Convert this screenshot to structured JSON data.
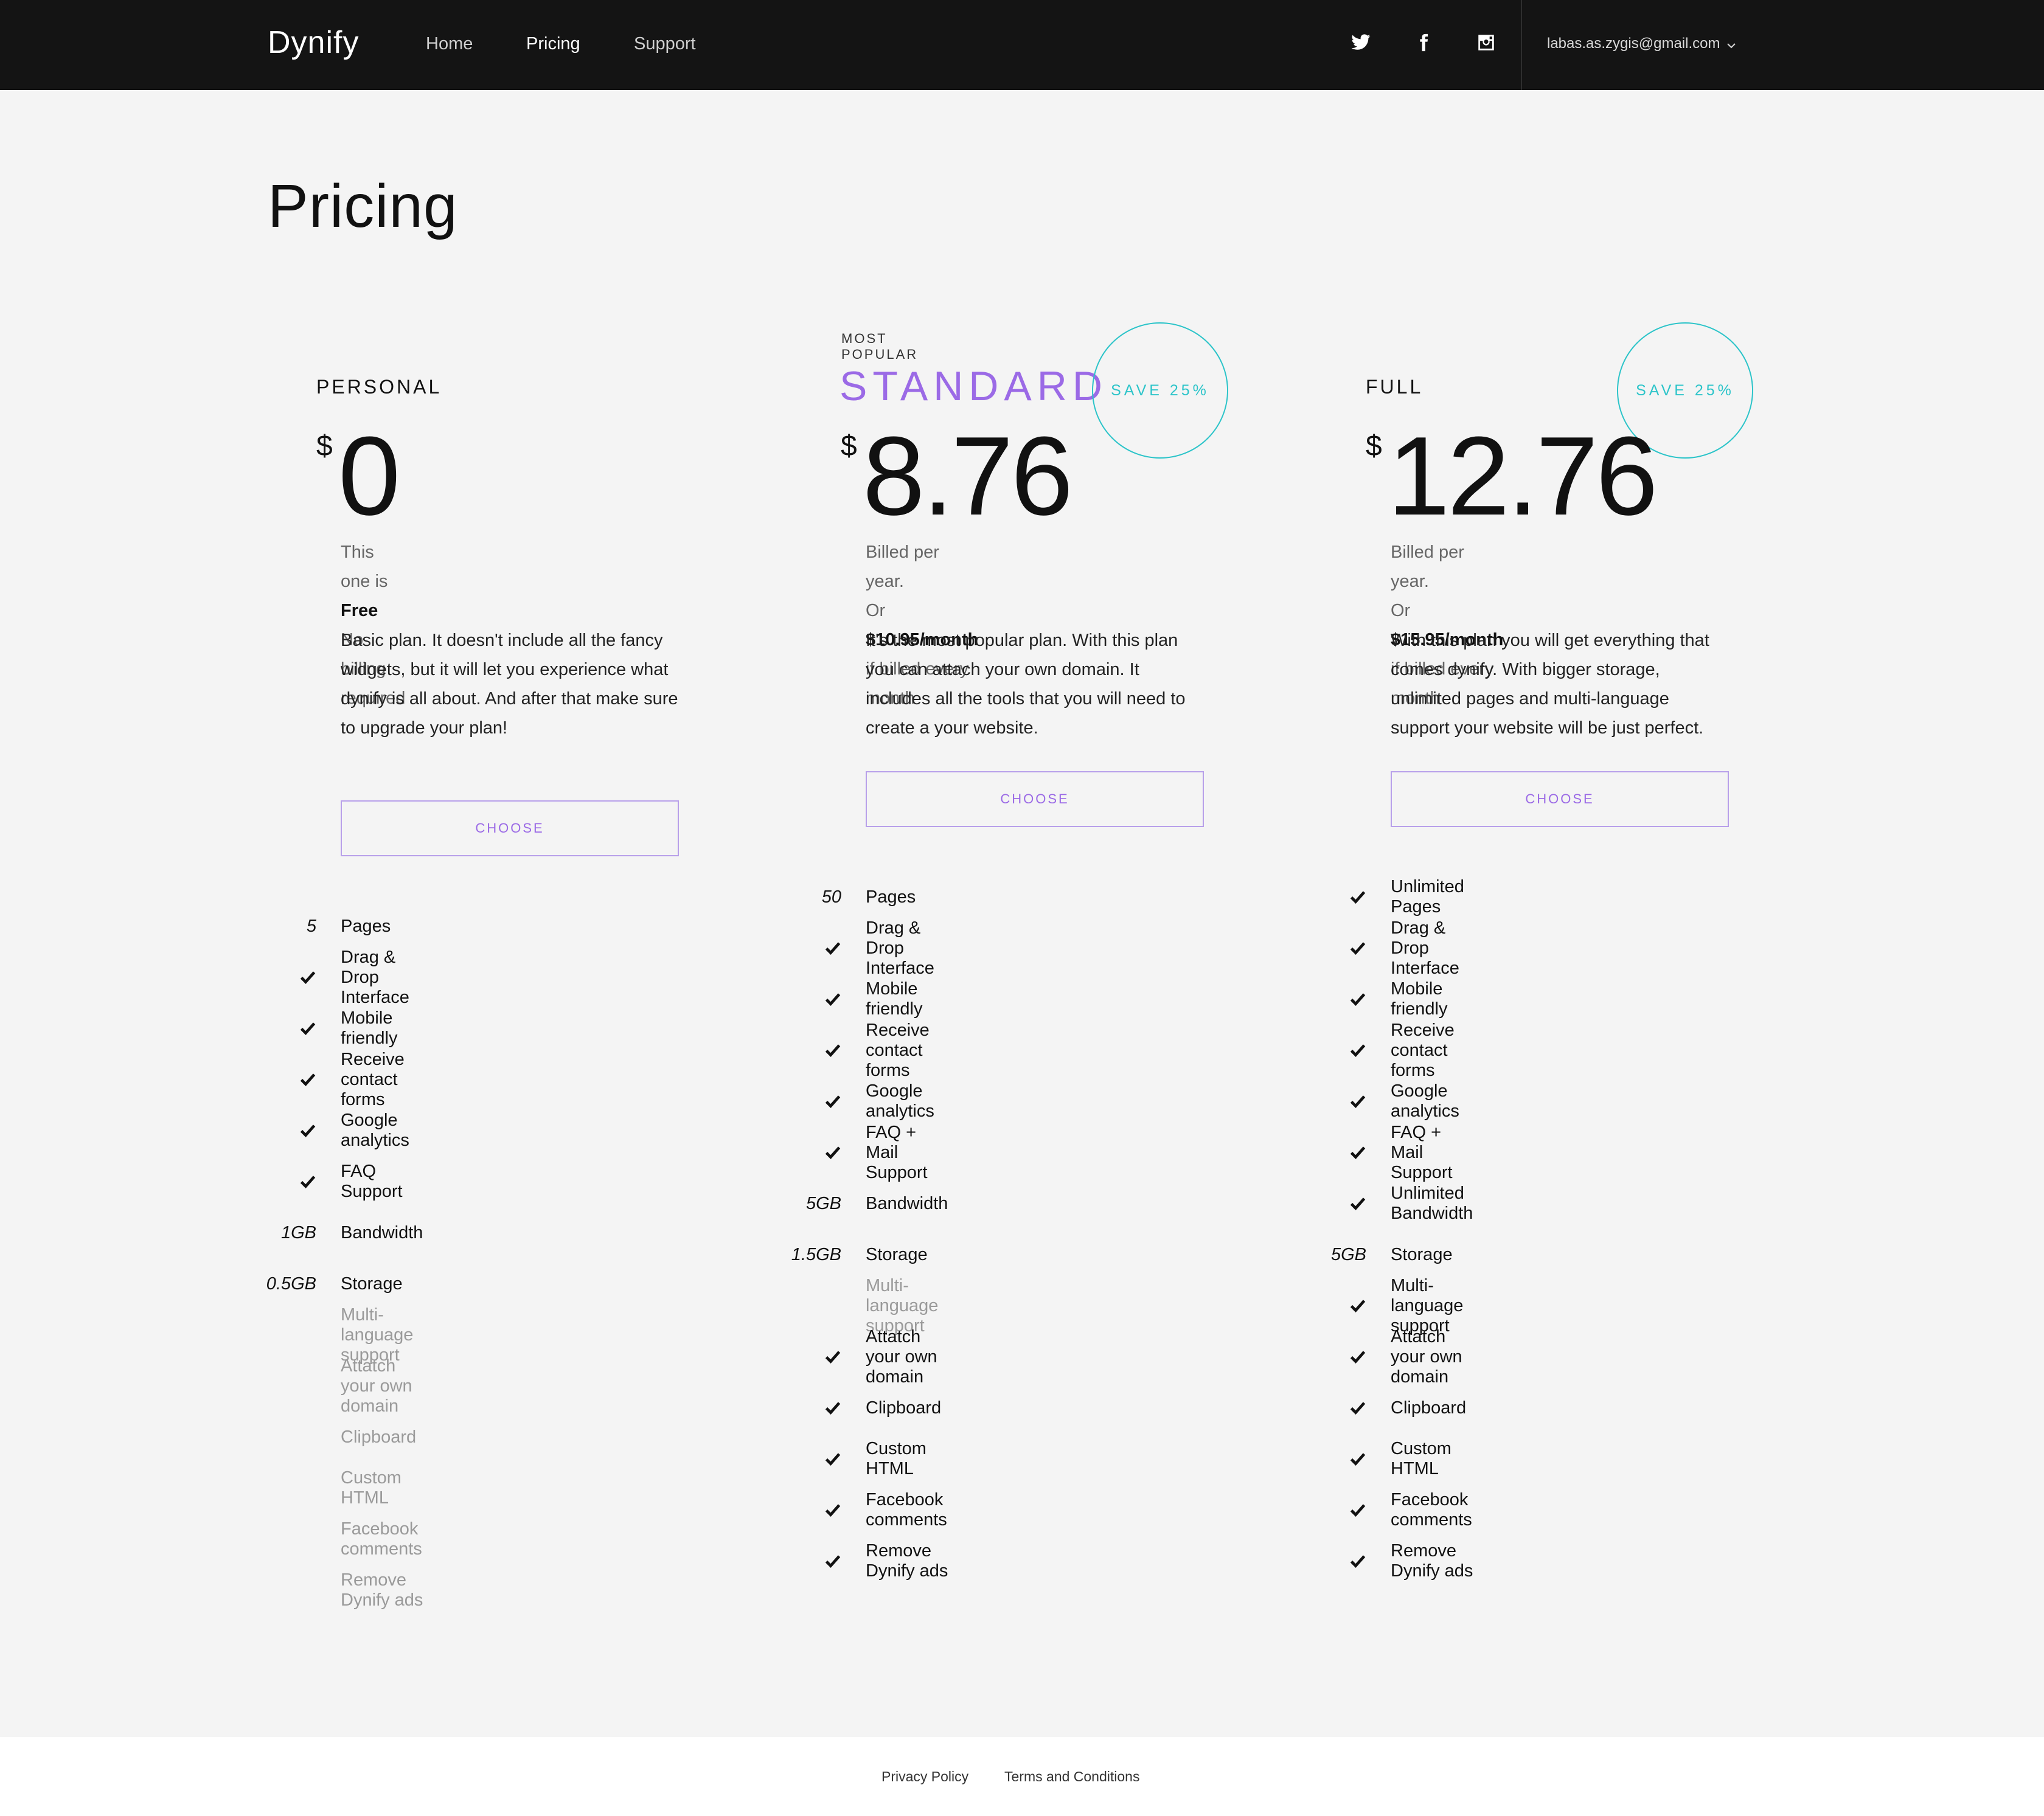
{
  "nav": {
    "brand": "Dynify",
    "links": [
      {
        "label": "Home"
      },
      {
        "label": "Pricing"
      },
      {
        "label": "Support"
      }
    ],
    "social": [
      "twitter-icon",
      "facebook-icon",
      "instagram-icon"
    ],
    "user_email": "labas.as.zygis@gmail.com"
  },
  "page": {
    "title": "Pricing"
  },
  "plans": [
    {
      "name": "PERSONAL",
      "currency": "$",
      "amount": "0",
      "billing_line1_pre": "This one is ",
      "billing_line1_bold": "Free",
      "billing_line2_pre": "No billing required",
      "description": "Basic plan. It doesn't include all the fancy widgets, but it will let you experience what dynify is all about. And after that make sure to upgrade your plan!",
      "cta": "CHOOSE",
      "features": [
        {
          "mark": "5",
          "label": "Pages"
        },
        {
          "mark": "check",
          "label": "Drag & Drop Interface"
        },
        {
          "mark": "check",
          "label": "Mobile friendly"
        },
        {
          "mark": "check",
          "label": "Receive contact forms"
        },
        {
          "mark": "check",
          "label": "Google analytics"
        },
        {
          "mark": "check",
          "label": "FAQ Support"
        },
        {
          "mark": "1GB",
          "label": "Bandwidth"
        },
        {
          "mark": "0.5GB",
          "label": "Storage"
        },
        {
          "mark": "",
          "label": "Multi-language support",
          "disabled": true
        },
        {
          "mark": "",
          "label": "Attatch your own domain",
          "disabled": true
        },
        {
          "mark": "",
          "label": "Clipboard",
          "disabled": true
        },
        {
          "mark": "",
          "label": "Custom HTML",
          "disabled": true
        },
        {
          "mark": "",
          "label": "Facebook comments",
          "disabled": true
        },
        {
          "mark": "",
          "label": "Remove Dynify ads",
          "disabled": true
        }
      ]
    },
    {
      "kicker": "MOST POPULAR",
      "name": "STANDARD",
      "badge": "SAVE 25%",
      "currency": "$",
      "amount": "8.76",
      "billing_line1_pre": "Billed per year.",
      "billing_line2_pre": "Or ",
      "billing_line2_bold": "$10.95/month",
      "billing_line2_post": " if billed every month",
      "description": "It's the most popular plan. With this plan you can attach your own domain. It includes all the tools that you will need to create a your website.",
      "cta": "CHOOSE",
      "features": [
        {
          "mark": "50",
          "label": "Pages"
        },
        {
          "mark": "check",
          "label": "Drag & Drop Interface"
        },
        {
          "mark": "check",
          "label": "Mobile friendly"
        },
        {
          "mark": "check",
          "label": "Receive contact forms"
        },
        {
          "mark": "check",
          "label": "Google analytics"
        },
        {
          "mark": "check",
          "label": "FAQ + Mail Support"
        },
        {
          "mark": "5GB",
          "label": "Bandwidth"
        },
        {
          "mark": "1.5GB",
          "label": "Storage"
        },
        {
          "mark": "",
          "label": "Multi-language support",
          "disabled": true
        },
        {
          "mark": "check",
          "label": "Attatch your own domain"
        },
        {
          "mark": "check",
          "label": "Clipboard"
        },
        {
          "mark": "check",
          "label": "Custom HTML"
        },
        {
          "mark": "check",
          "label": "Facebook comments"
        },
        {
          "mark": "check",
          "label": "Remove Dynify ads"
        }
      ]
    },
    {
      "name": "FULL",
      "badge": "SAVE 25%",
      "currency": "$",
      "amount": "12.76",
      "billing_line1_pre": "Billed per year.",
      "billing_line2_pre": "Or ",
      "billing_line2_bold": "$15.95/month",
      "billing_line2_post": " if billed every month",
      "description": "With this plan you will get everything that comes dynify. With bigger storage, unlimited pages and multi-language support your website will be just perfect.",
      "cta": "CHOOSE",
      "features": [
        {
          "mark": "check",
          "label": "Unlimited Pages"
        },
        {
          "mark": "check",
          "label": "Drag & Drop Interface"
        },
        {
          "mark": "check",
          "label": "Mobile friendly"
        },
        {
          "mark": "check",
          "label": "Receive contact forms"
        },
        {
          "mark": "check",
          "label": "Google analytics"
        },
        {
          "mark": "check",
          "label": "FAQ + Mail Support"
        },
        {
          "mark": "check",
          "label": "Unlimited Bandwidth"
        },
        {
          "mark": "5GB",
          "label": "Storage"
        },
        {
          "mark": "check",
          "label": "Multi-language support"
        },
        {
          "mark": "check",
          "label": "Attatch your own domain"
        },
        {
          "mark": "check",
          "label": "Clipboard"
        },
        {
          "mark": "check",
          "label": "Custom HTML"
        },
        {
          "mark": "check",
          "label": "Facebook comments"
        },
        {
          "mark": "check",
          "label": "Remove Dynify ads"
        }
      ]
    }
  ],
  "footer": {
    "links": [
      {
        "label": "Privacy Policy"
      },
      {
        "label": "Terms and Conditions"
      }
    ]
  },
  "colors": {
    "accent_purple": "#9b6ae6",
    "accent_teal": "#2cc4c9",
    "nav_bg": "#141414",
    "page_bg": "#f4f4f4"
  }
}
